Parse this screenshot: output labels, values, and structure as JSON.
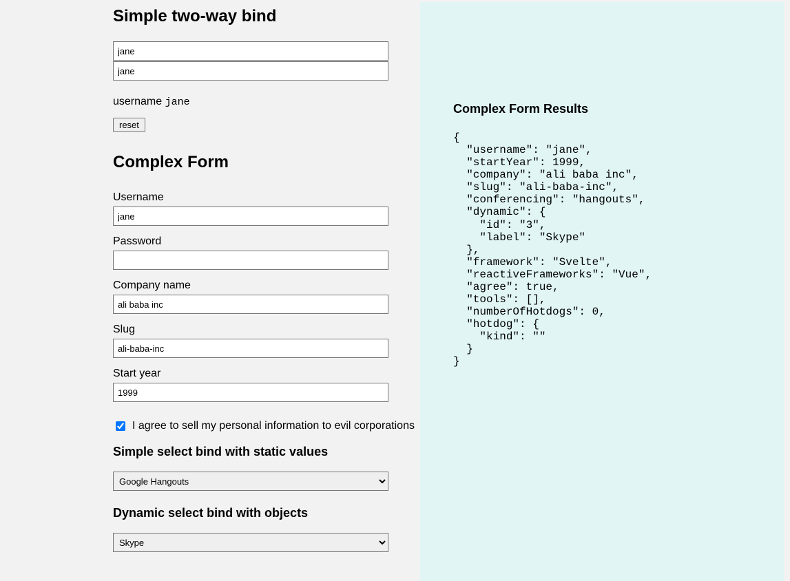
{
  "simple": {
    "heading": "Simple two-way bind",
    "input1": "jane",
    "input2": "jane",
    "usernameLabel": "username",
    "usernameValue": "jane",
    "resetLabel": "reset"
  },
  "complex": {
    "heading": "Complex Form",
    "fields": {
      "username": {
        "label": "Username",
        "value": "jane"
      },
      "password": {
        "label": "Password",
        "value": ""
      },
      "company": {
        "label": "Company name",
        "value": "ali baba inc"
      },
      "slug": {
        "label": "Slug",
        "value": "ali-baba-inc"
      },
      "startYear": {
        "label": "Start year",
        "value": "1999"
      }
    },
    "agree": {
      "checked": true,
      "label": "I agree to sell my personal information to evil corporations"
    },
    "simpleSelect": {
      "heading": "Simple select bind with static values",
      "selected": "Google Hangouts"
    },
    "dynamicSelect": {
      "heading": "Dynamic select bind with objects",
      "selected": "Skype"
    }
  },
  "results": {
    "heading": "Complex Form Results",
    "json": "{\n  \"username\": \"jane\",\n  \"startYear\": 1999,\n  \"company\": \"ali baba inc\",\n  \"slug\": \"ali-baba-inc\",\n  \"conferencing\": \"hangouts\",\n  \"dynamic\": {\n    \"id\": \"3\",\n    \"label\": \"Skype\"\n  },\n  \"framework\": \"Svelte\",\n  \"reactiveFrameworks\": \"Vue\",\n  \"agree\": true,\n  \"tools\": [],\n  \"numberOfHotdogs\": 0,\n  \"hotdog\": {\n    \"kind\": \"\"\n  }\n}"
  }
}
